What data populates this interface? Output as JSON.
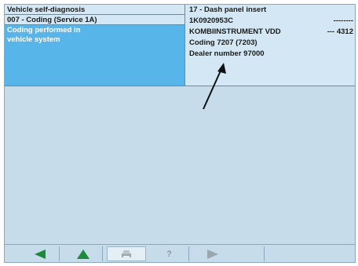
{
  "left": {
    "row1": "Vehicle self-diagnosis",
    "row2": "007 - Coding (Service 1A)",
    "selected_line1": "Coding performed in",
    "selected_line2": "vehicle system"
  },
  "right": {
    "line1": "17 - Dash panel insert",
    "line2": "1K0920953C",
    "line3": "KOMBIINSTRUMENT VDD",
    "line4": "Coding 7207 (7203)",
    "line5": "Dealer number 97000",
    "dashes_top": "--------",
    "dashes_value": "--- 4312"
  },
  "toolbar": {
    "buttons": [
      "back-arrow",
      "up-arrow",
      "print",
      "help",
      "forward-arrow"
    ]
  },
  "colors": {
    "background": "#c7dcea",
    "header": "#d3e8f4",
    "selection": "#58b5ea",
    "green": "#1c8a3a"
  }
}
